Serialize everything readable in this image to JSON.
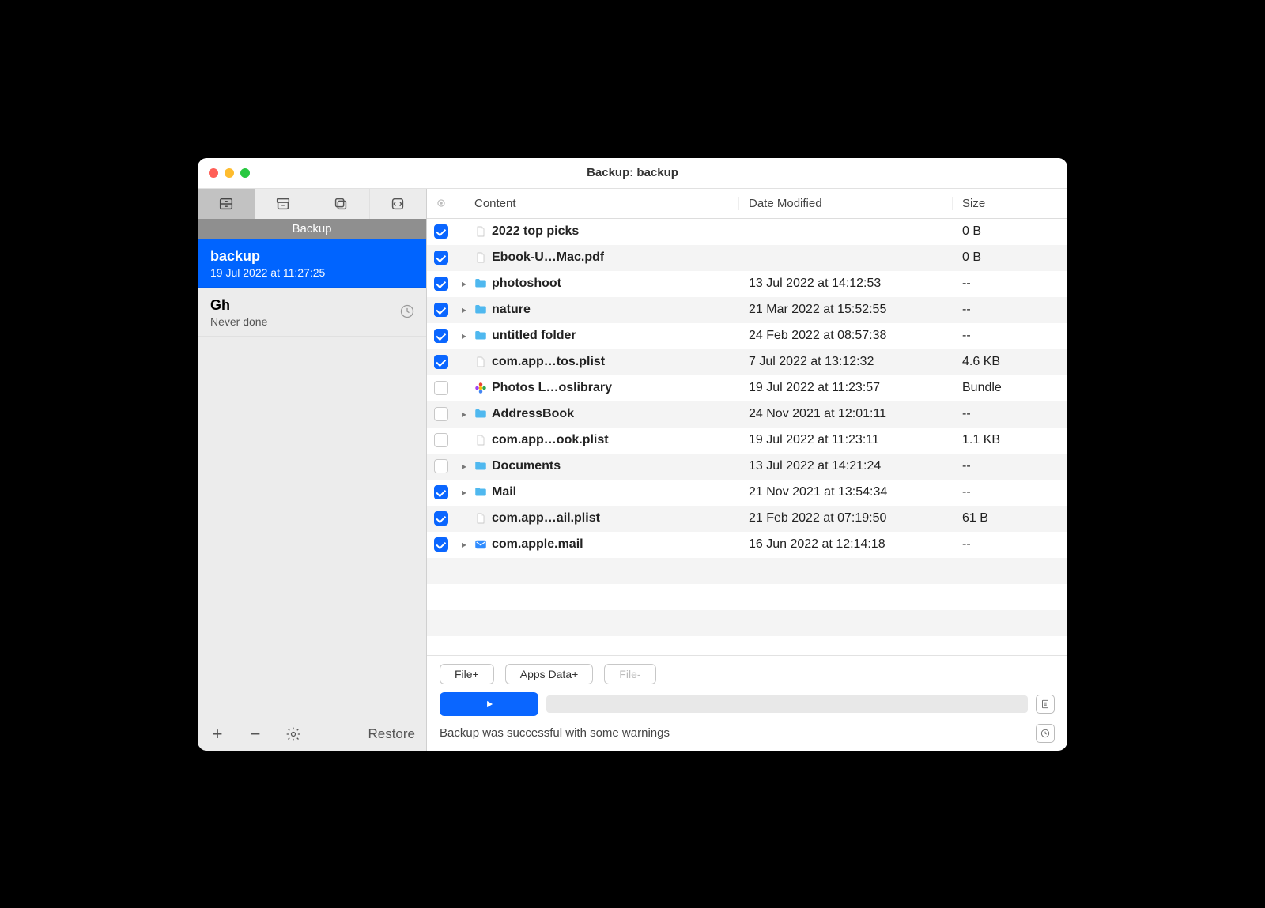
{
  "window_title": "Backup: backup",
  "sidebar": {
    "heading": "Backup",
    "items": [
      {
        "name": "backup",
        "sub": "19 Jul 2022 at 11:27:25",
        "selected": true,
        "show_clock": false
      },
      {
        "name": "Gh",
        "sub": "Never done",
        "selected": false,
        "show_clock": true
      }
    ],
    "restore_label": "Restore"
  },
  "columns": {
    "content": "Content",
    "date": "Date Modified",
    "size": "Size"
  },
  "rows": [
    {
      "checked": true,
      "expandable": false,
      "icon": "file",
      "name": "2022 top picks",
      "date": "",
      "size": "0 B"
    },
    {
      "checked": true,
      "expandable": false,
      "icon": "file",
      "name": "Ebook-U…Mac.pdf",
      "date": "",
      "size": "0 B"
    },
    {
      "checked": true,
      "expandable": true,
      "icon": "folder",
      "name": "photoshoot",
      "date": "13 Jul 2022 at 14:12:53",
      "size": "--"
    },
    {
      "checked": true,
      "expandable": true,
      "icon": "folder",
      "name": "nature",
      "date": "21 Mar 2022 at 15:52:55",
      "size": "--"
    },
    {
      "checked": true,
      "expandable": true,
      "icon": "folder",
      "name": "untitled folder",
      "date": "24 Feb 2022 at 08:57:38",
      "size": "--"
    },
    {
      "checked": true,
      "expandable": false,
      "icon": "file",
      "name": "com.app…tos.plist",
      "date": "7 Jul 2022 at 13:12:32",
      "size": "4.6 KB"
    },
    {
      "checked": false,
      "expandable": false,
      "icon": "photos",
      "name": "Photos L…oslibrary",
      "date": "19 Jul 2022 at 11:23:57",
      "size": "Bundle"
    },
    {
      "checked": false,
      "expandable": true,
      "icon": "folder",
      "name": "AddressBook",
      "date": "24 Nov 2021 at 12:01:11",
      "size": "--"
    },
    {
      "checked": false,
      "expandable": false,
      "icon": "file",
      "name": "com.app…ook.plist",
      "date": "19 Jul 2022 at 11:23:11",
      "size": "1.1 KB"
    },
    {
      "checked": false,
      "expandable": true,
      "icon": "folder",
      "name": "Documents",
      "date": "13 Jul 2022 at 14:21:24",
      "size": "--"
    },
    {
      "checked": true,
      "expandable": true,
      "icon": "folder",
      "name": "Mail",
      "date": "21 Nov 2021 at 13:54:34",
      "size": "--"
    },
    {
      "checked": true,
      "expandable": false,
      "icon": "file",
      "name": "com.app…ail.plist",
      "date": "21 Feb 2022 at 07:19:50",
      "size": "61 B"
    },
    {
      "checked": true,
      "expandable": true,
      "icon": "mailapp",
      "name": "com.apple.mail",
      "date": "16 Jun 2022 at 12:14:18",
      "size": "--"
    }
  ],
  "buttons": {
    "file_add": "File+",
    "apps_data_add": "Apps Data+",
    "file_remove": "File-"
  },
  "status": "Backup was successful with some warnings"
}
